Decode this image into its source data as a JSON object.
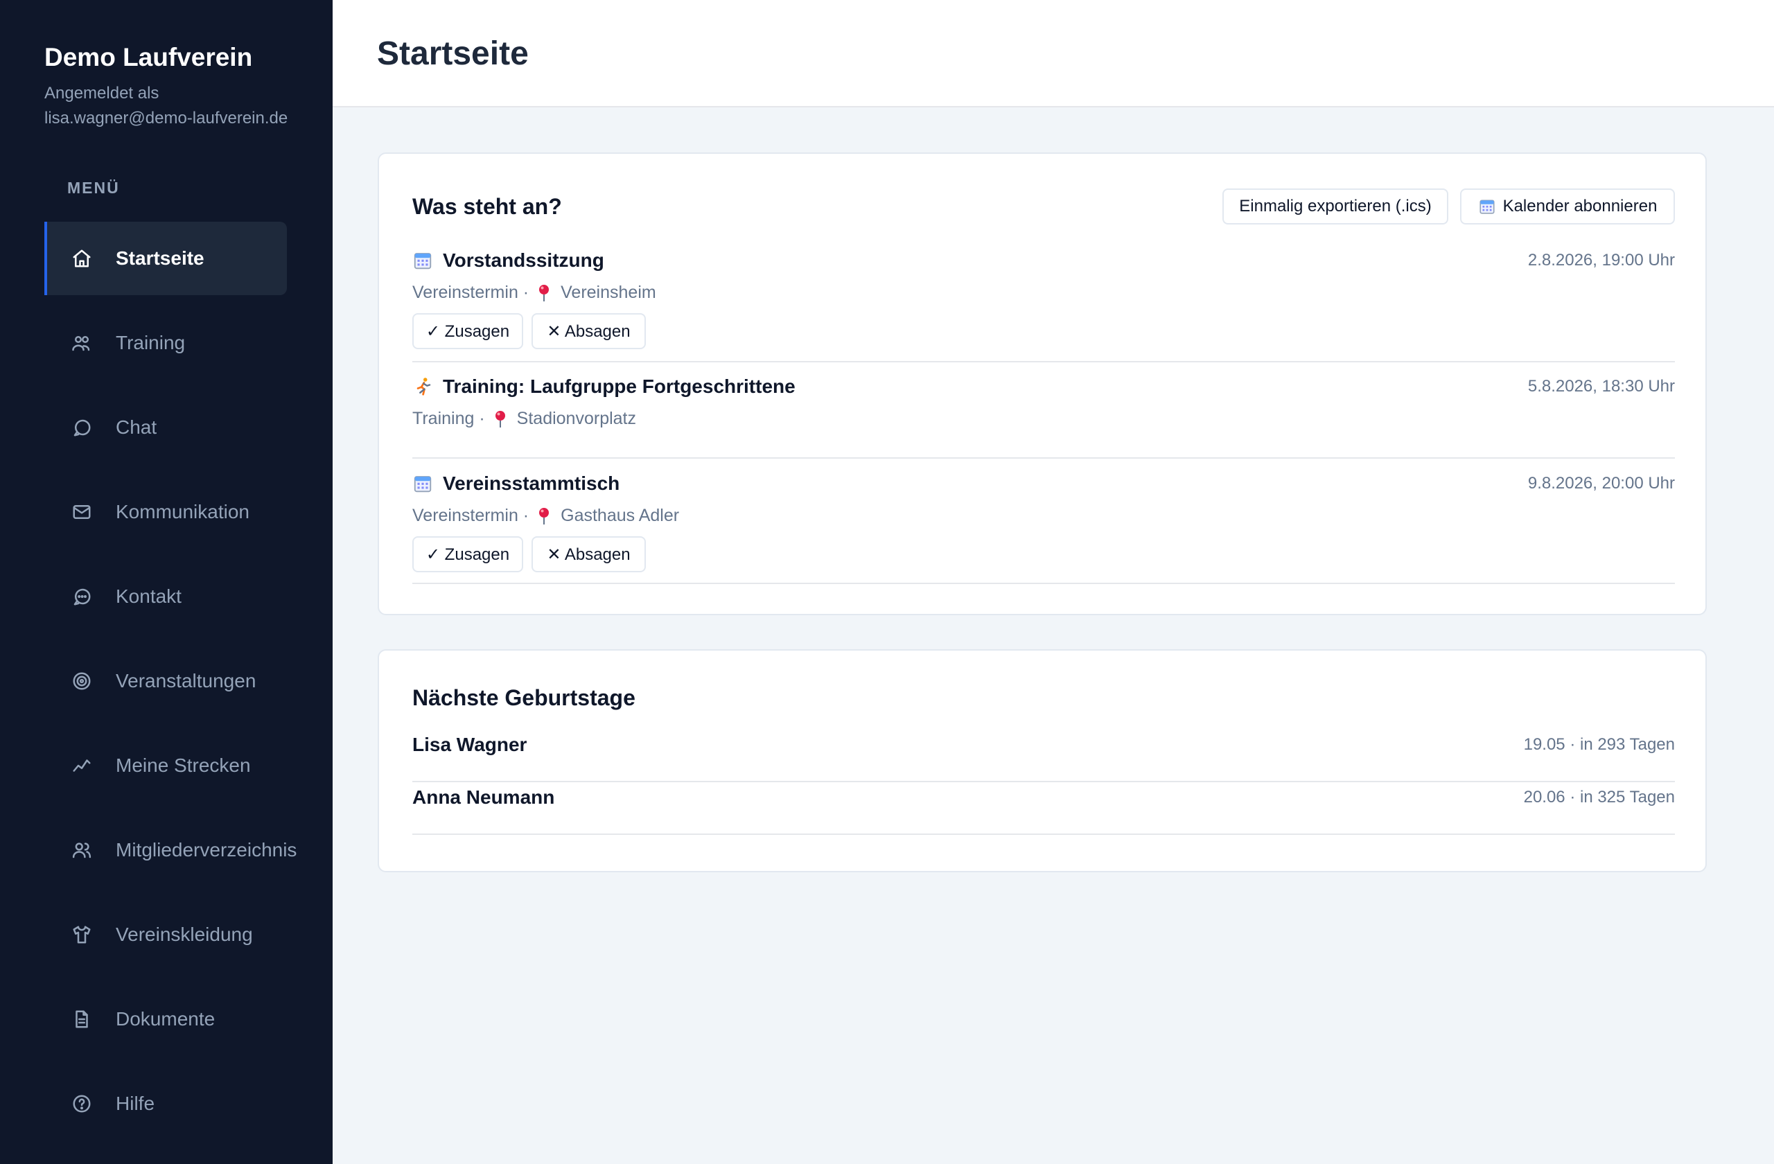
{
  "sidebar": {
    "brand": "Demo Laufverein",
    "logged_in_label": "Angemeldet als",
    "logged_in_email": "lisa.wagner@demo-laufverein.de",
    "menu_heading": "MENÜ",
    "items": [
      {
        "label": "Startseite",
        "icon": "home-icon",
        "active": true
      },
      {
        "label": "Training",
        "icon": "users-icon"
      },
      {
        "label": "Chat",
        "icon": "chat-bubble-icon"
      },
      {
        "label": "Kommunikation",
        "icon": "mail-icon"
      },
      {
        "label": "Kontakt",
        "icon": "message-dots-icon"
      },
      {
        "label": "Veranstaltungen",
        "icon": "target-icon"
      },
      {
        "label": "Meine Strecken",
        "icon": "trend-line-icon"
      },
      {
        "label": "Mitgliederverzeichnis",
        "icon": "members-icon"
      },
      {
        "label": "Vereinskleidung",
        "icon": "shirt-icon"
      },
      {
        "label": "Dokumente",
        "icon": "document-icon"
      },
      {
        "label": "Hilfe",
        "icon": "help-circle-icon"
      }
    ]
  },
  "header": {
    "title": "Startseite"
  },
  "upcoming": {
    "title": "Was steht an?",
    "export_label": "Einmalig exportieren (.ics)",
    "subscribe_label": "Kalender abonnieren",
    "accept_label": "✓ Zusagen",
    "decline_label": "✕ Absagen",
    "events": [
      {
        "title": "Vorstandssitzung",
        "icon": "calendar-icon",
        "type": "Vereinstermin ·",
        "location": "Vereinsheim",
        "date": "2.8.2026, 19:00 Uhr",
        "rsvp": true
      },
      {
        "title": "Training: Laufgruppe Fortgeschrittene",
        "icon": "runner-icon",
        "type": "Training ·",
        "location": "Stadionvorplatz",
        "date": "5.8.2026, 18:30 Uhr",
        "rsvp": false
      },
      {
        "title": "Vereinsstammtisch",
        "icon": "calendar-icon",
        "type": "Vereinstermin ·",
        "location": "Gasthaus Adler",
        "date": "9.8.2026, 20:00 Uhr",
        "rsvp": true
      }
    ]
  },
  "birthdays": {
    "title": "Nächste Geburtstage",
    "items": [
      {
        "name": "Lisa Wagner",
        "info": "19.05 · in 293 Tagen"
      },
      {
        "name": "Anna Neumann",
        "info": "20.06 · in 325 Tagen"
      }
    ]
  },
  "colors": {
    "sidebar_bg": "#0f172a",
    "accent": "#2563eb",
    "page_bg": "#f1f5f9",
    "muted_text": "#64748b"
  }
}
